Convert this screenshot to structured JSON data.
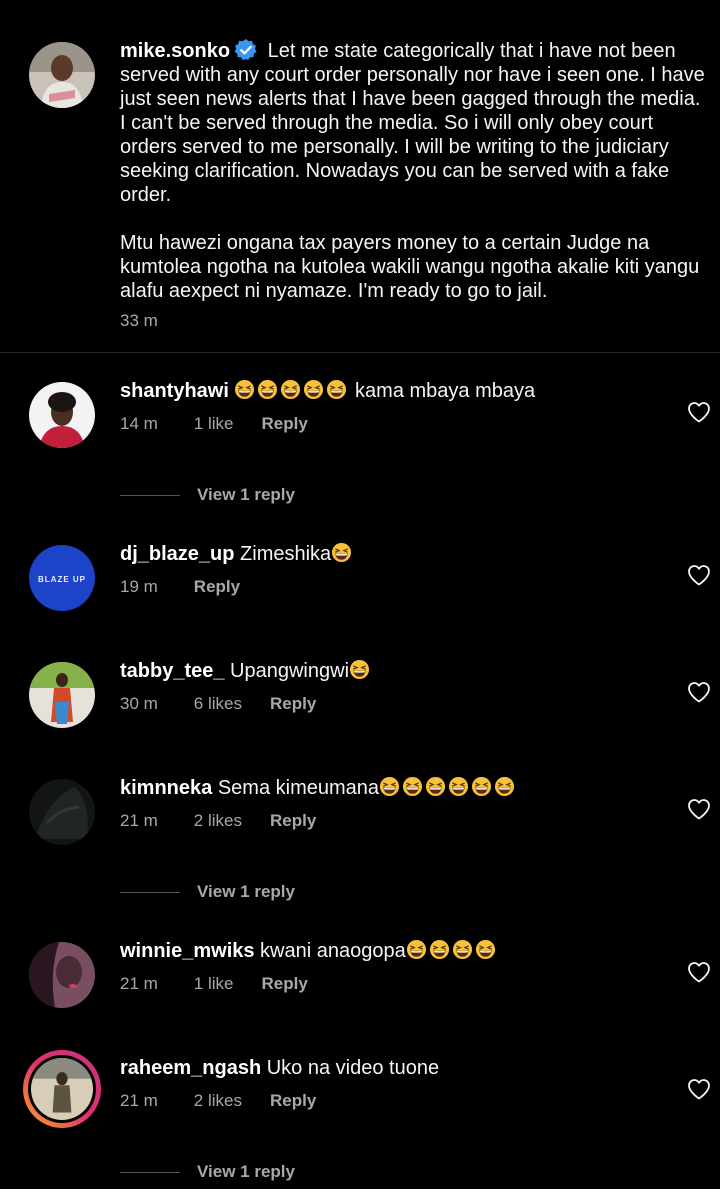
{
  "caption": {
    "username": "mike.sonko",
    "paragraph1": "Let me state categorically that i have not been served with any court order personally nor have i seen one. I have just seen news alerts that I have been gagged through the media. I can't be served through the media. So i will only obey court orders served to me personally. I will be writing to the judiciary seeking clarification. Nowadays you can be served with a fake order.",
    "paragraph2": "Mtu hawezi ongana  tax payers money to a certain Judge na kumtolea ngotha na kutolea wakili wangu ngotha akalie kiti yangu alafu aexpect ni nyamaze. I'm ready to go to jail.",
    "time": "33 m",
    "verified_icon": "verified-badge-icon",
    "verified_color": "#3897f0"
  },
  "comments": [
    {
      "username": "shantyhawi",
      "emoji_before": 5,
      "text": " kama mbaya mbaya",
      "emoji_after": 0,
      "time": "14 m",
      "likes": "1 like",
      "reply": "Reply",
      "view_replies": "View 1 reply"
    },
    {
      "username": "dj_blaze_up",
      "emoji_before": 0,
      "text": " Zimeshika",
      "emoji_after": 1,
      "time": "19 m",
      "likes": "",
      "reply": "Reply",
      "view_replies": "",
      "avatar_text": "BLAZE UP"
    },
    {
      "username": "tabby_tee_",
      "emoji_before": 0,
      "text": " Upangwingwi",
      "emoji_after": 1,
      "time": "30 m",
      "likes": "6 likes",
      "reply": "Reply",
      "view_replies": ""
    },
    {
      "username": "kimnneka",
      "emoji_before": 0,
      "text": " Sema kimeumana",
      "emoji_after": 6,
      "time": "21 m",
      "likes": "2 likes",
      "reply": "Reply",
      "view_replies": "View 1 reply"
    },
    {
      "username": "winnie_mwiks",
      "emoji_before": 0,
      "text": " kwani anaogopa",
      "emoji_after": 4,
      "time": "21 m",
      "likes": "1 like",
      "reply": "Reply",
      "view_replies": ""
    },
    {
      "username": "raheem_ngash",
      "emoji_before": 0,
      "text": " Uko na video tuone",
      "emoji_after": 0,
      "time": "21 m",
      "likes": "2 likes",
      "reply": "Reply",
      "view_replies": "View 1 reply"
    }
  ],
  "icons": {
    "like": "heart-outline-icon",
    "emoji": "grinning-squinting-face-emoji"
  }
}
